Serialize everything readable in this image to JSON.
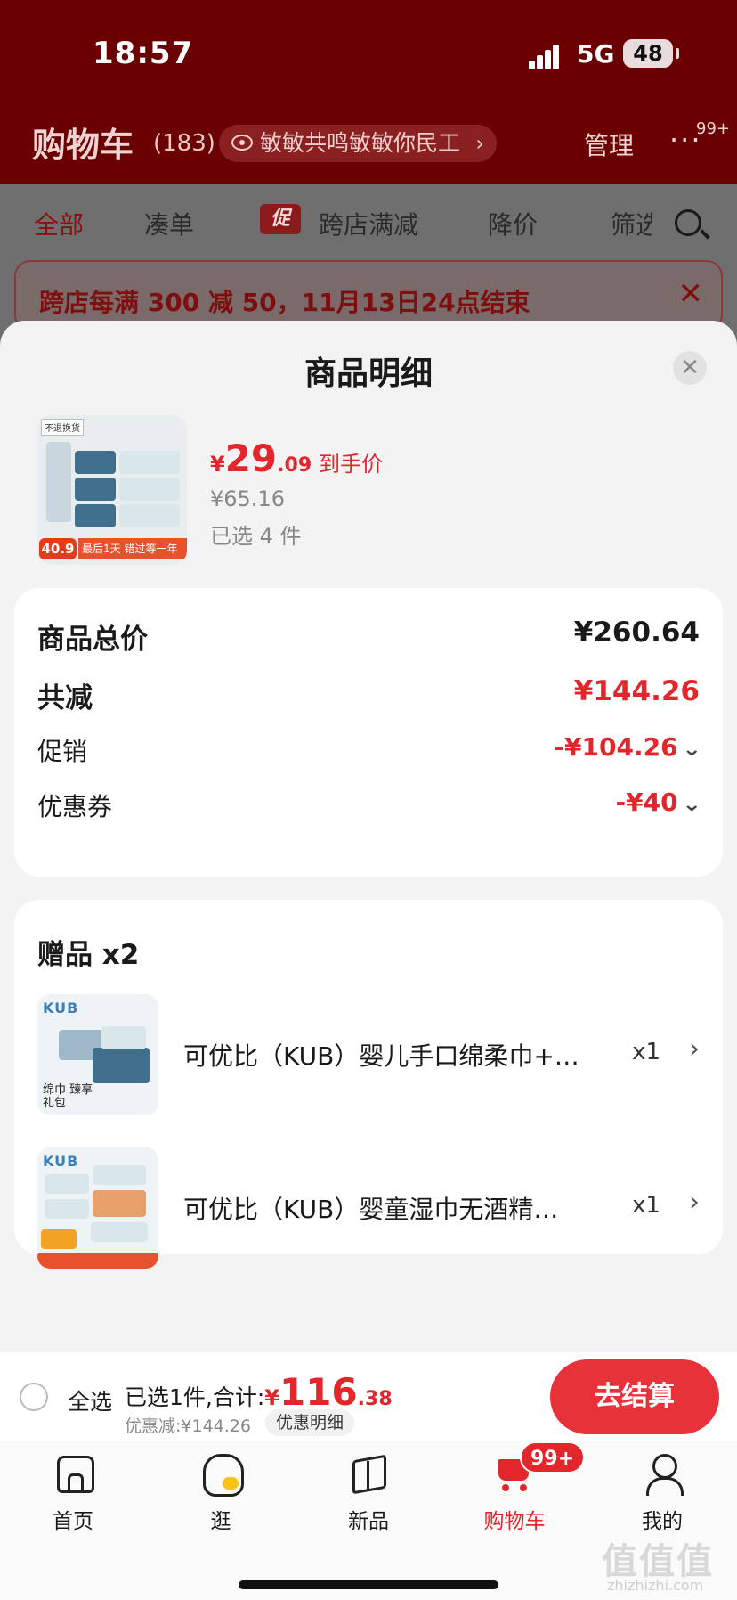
{
  "status_bar": {
    "time": "18:57",
    "network": "5G",
    "battery": "48"
  },
  "header": {
    "title": "购物车",
    "count": "(183)",
    "address": "敏敏共鸣敏敏你民工",
    "manage": "管理",
    "more_badge": "99+"
  },
  "tabs": {
    "all": "全部",
    "bundle": "凑单",
    "promo_tag": "促",
    "cross_store": "跨店满减",
    "price_drop": "降价",
    "filter": "筛选"
  },
  "banner": {
    "text": "跨店每满 300 减 50，11月13日24点结束"
  },
  "sheet": {
    "title": "商品明细",
    "product": {
      "currency": "¥",
      "price_int": "29",
      "price_dec": ".09",
      "price_label": "到手价",
      "original_price": "¥65.16",
      "selected": "已选 4 件",
      "image_price": "40.9",
      "image_strip": "最后1天 错过等一年",
      "image_tag": "不退换货"
    },
    "breakdown": {
      "total_label": "商品总价",
      "total_value": "¥260.64",
      "reduce_label": "共减",
      "reduce_value": "¥144.26",
      "promo_label": "促销",
      "promo_value": "-¥104.26",
      "coupon_label": "优惠券",
      "coupon_value": "-¥40"
    },
    "gifts": {
      "title": "赠品 x2",
      "items": [
        {
          "name": "可优比（KUB）婴儿手口绵柔巾+…",
          "qty": "x1",
          "brand": "KUB",
          "caption": "绵巾 臻享礼包"
        },
        {
          "name": "可优比（KUB）婴童湿巾无酒精…",
          "qty": "x1",
          "brand": "KUB",
          "caption": ""
        }
      ]
    }
  },
  "checkout": {
    "select_all": "全选",
    "summary_prefix": "已选1件,合计:",
    "total_currency": "¥",
    "total_int": "116",
    "total_dec": ".38",
    "discount": "优惠减:¥144.26",
    "detail": "优惠明细",
    "pay": "去结算"
  },
  "tabbar": {
    "home": "首页",
    "browse": "逛",
    "new": "新品",
    "cart": "购物车",
    "cart_badge": "99+",
    "me": "我的"
  },
  "watermark": {
    "main": "值值值",
    "sub": "zhizhizhi.com"
  },
  "colors": {
    "accent": "#e3262c",
    "header_bg": "#6b0000"
  }
}
